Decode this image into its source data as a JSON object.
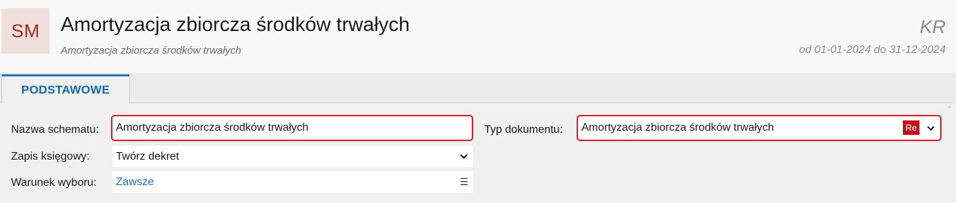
{
  "header": {
    "avatar_text": "SM",
    "title": "Amortyzacja zbiorcza środków trwałych",
    "subtitle": "Amortyzacja zbiorcza środków trwałych",
    "code": "KR",
    "period": "od 01-01-2024 do 31-12-2024"
  },
  "tabs": [
    {
      "label": "PODSTAWOWE",
      "active": true
    }
  ],
  "form": {
    "scheme_name": {
      "label": "Nazwa schematu:",
      "value": "Amortyzacja zbiorcza środków trwałych"
    },
    "posting": {
      "label": "Zapis księgowy:",
      "value": "Twórz dekret"
    },
    "condition": {
      "label": "Warunek wyboru:",
      "value": "Zawsze"
    },
    "doc_type": {
      "label": "Typ dokumentu:",
      "value": "Amortyzacja zbiorcza środków trwałych",
      "badge": "Re"
    }
  },
  "colors": {
    "accent_blue": "#1e74b8",
    "brand_red": "#c0131b",
    "highlight_border": "#d81b22"
  }
}
